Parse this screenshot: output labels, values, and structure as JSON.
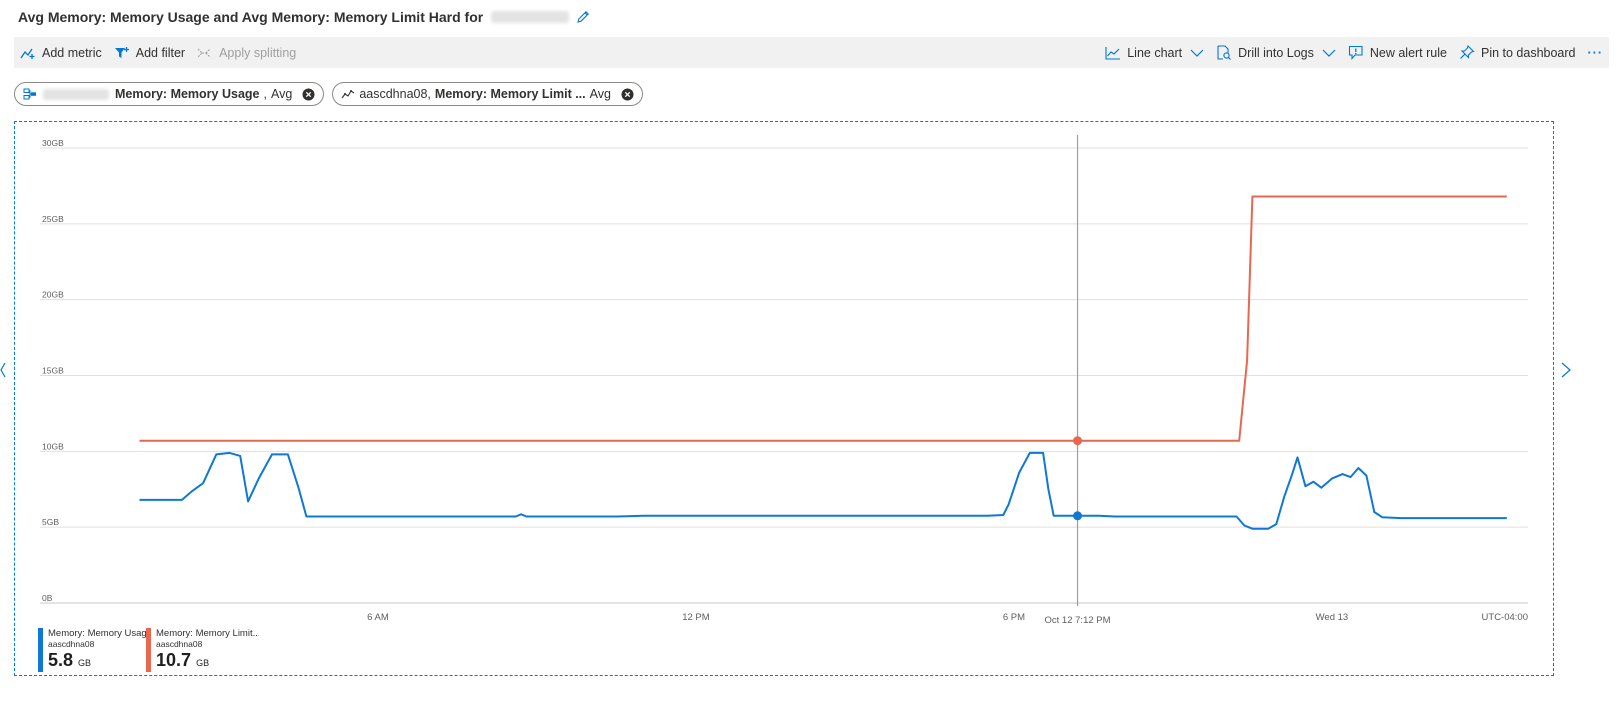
{
  "header": {
    "title": "Avg Memory: Memory Usage and Avg Memory: Memory Limit Hard for"
  },
  "toolbar": {
    "add_metric": "Add metric",
    "add_filter": "Add filter",
    "apply_splitting": "Apply splitting",
    "line_chart": "Line chart",
    "drill_logs": "Drill into Logs",
    "new_alert": "New alert rule",
    "pin": "Pin to dashboard",
    "more": "···"
  },
  "pills": [
    {
      "metric": "Memory: Memory Usage",
      "agg": "Avg"
    },
    {
      "resource": "aascdhna08,",
      "metric": "Memory: Memory Limit ...",
      "agg": "Avg"
    }
  ],
  "chart_data": {
    "type": "line",
    "ylim": [
      0,
      30
    ],
    "y_ticks": [
      "0B",
      "5GB",
      "10GB",
      "15GB",
      "20GB",
      "25GB",
      "30GB"
    ],
    "x_ticks": [
      {
        "label": "6 AM",
        "h": 6
      },
      {
        "label": "12 PM",
        "h": 12
      },
      {
        "label": "6 PM",
        "h": 18
      },
      {
        "label": "Wed 13",
        "h": 24
      }
    ],
    "timezone": "UTC-04:00",
    "cursor": {
      "label": "Oct 12 7:12 PM",
      "h": 19.2
    },
    "colors": {
      "usage": "#0f78d4",
      "limit": "#e8674f"
    },
    "series": [
      {
        "name": "Memory: Memory Usage",
        "resource": "aascdhna08",
        "value": "5.8",
        "unit": "GB",
        "color": "#0f78d4",
        "points": [
          [
            1.5,
            6.8
          ],
          [
            2.3,
            6.8
          ],
          [
            2.5,
            7.4
          ],
          [
            2.7,
            7.9
          ],
          [
            2.95,
            9.8
          ],
          [
            3.2,
            9.9
          ],
          [
            3.4,
            9.7
          ],
          [
            3.55,
            6.7
          ],
          [
            3.75,
            8.2
          ],
          [
            4.0,
            9.8
          ],
          [
            4.3,
            9.8
          ],
          [
            4.5,
            7.6
          ],
          [
            4.65,
            5.7
          ],
          [
            7.0,
            5.7
          ],
          [
            8.6,
            5.7
          ],
          [
            8.7,
            5.85
          ],
          [
            8.8,
            5.7
          ],
          [
            10.5,
            5.7
          ],
          [
            11.0,
            5.75
          ],
          [
            17.5,
            5.75
          ],
          [
            17.8,
            5.8
          ],
          [
            17.9,
            6.5
          ],
          [
            18.1,
            8.6
          ],
          [
            18.3,
            9.9
          ],
          [
            18.55,
            9.9
          ],
          [
            18.65,
            7.5
          ],
          [
            18.75,
            5.75
          ],
          [
            19.2,
            5.75
          ],
          [
            19.6,
            5.75
          ],
          [
            19.9,
            5.7
          ],
          [
            22.2,
            5.7
          ],
          [
            22.35,
            5.1
          ],
          [
            22.5,
            4.9
          ],
          [
            22.8,
            4.9
          ],
          [
            22.95,
            5.2
          ],
          [
            23.1,
            7.0
          ],
          [
            23.25,
            8.5
          ],
          [
            23.35,
            9.6
          ],
          [
            23.5,
            7.7
          ],
          [
            23.65,
            8.0
          ],
          [
            23.8,
            7.6
          ],
          [
            24.0,
            8.2
          ],
          [
            24.2,
            8.5
          ],
          [
            24.35,
            8.3
          ],
          [
            24.5,
            8.9
          ],
          [
            24.65,
            8.4
          ],
          [
            24.8,
            6.0
          ],
          [
            24.95,
            5.65
          ],
          [
            25.3,
            5.6
          ],
          [
            26.4,
            5.6
          ],
          [
            27.3,
            5.6
          ]
        ]
      },
      {
        "name": "Memory: Memory Limit...",
        "resource": "aascdhna08",
        "value": "10.7",
        "unit": "GB",
        "color": "#e8674f",
        "points": [
          [
            1.5,
            10.7
          ],
          [
            19.2,
            10.7
          ],
          [
            22.25,
            10.7
          ],
          [
            22.4,
            16.0
          ],
          [
            22.5,
            26.8
          ],
          [
            27.3,
            26.8
          ]
        ]
      }
    ]
  }
}
